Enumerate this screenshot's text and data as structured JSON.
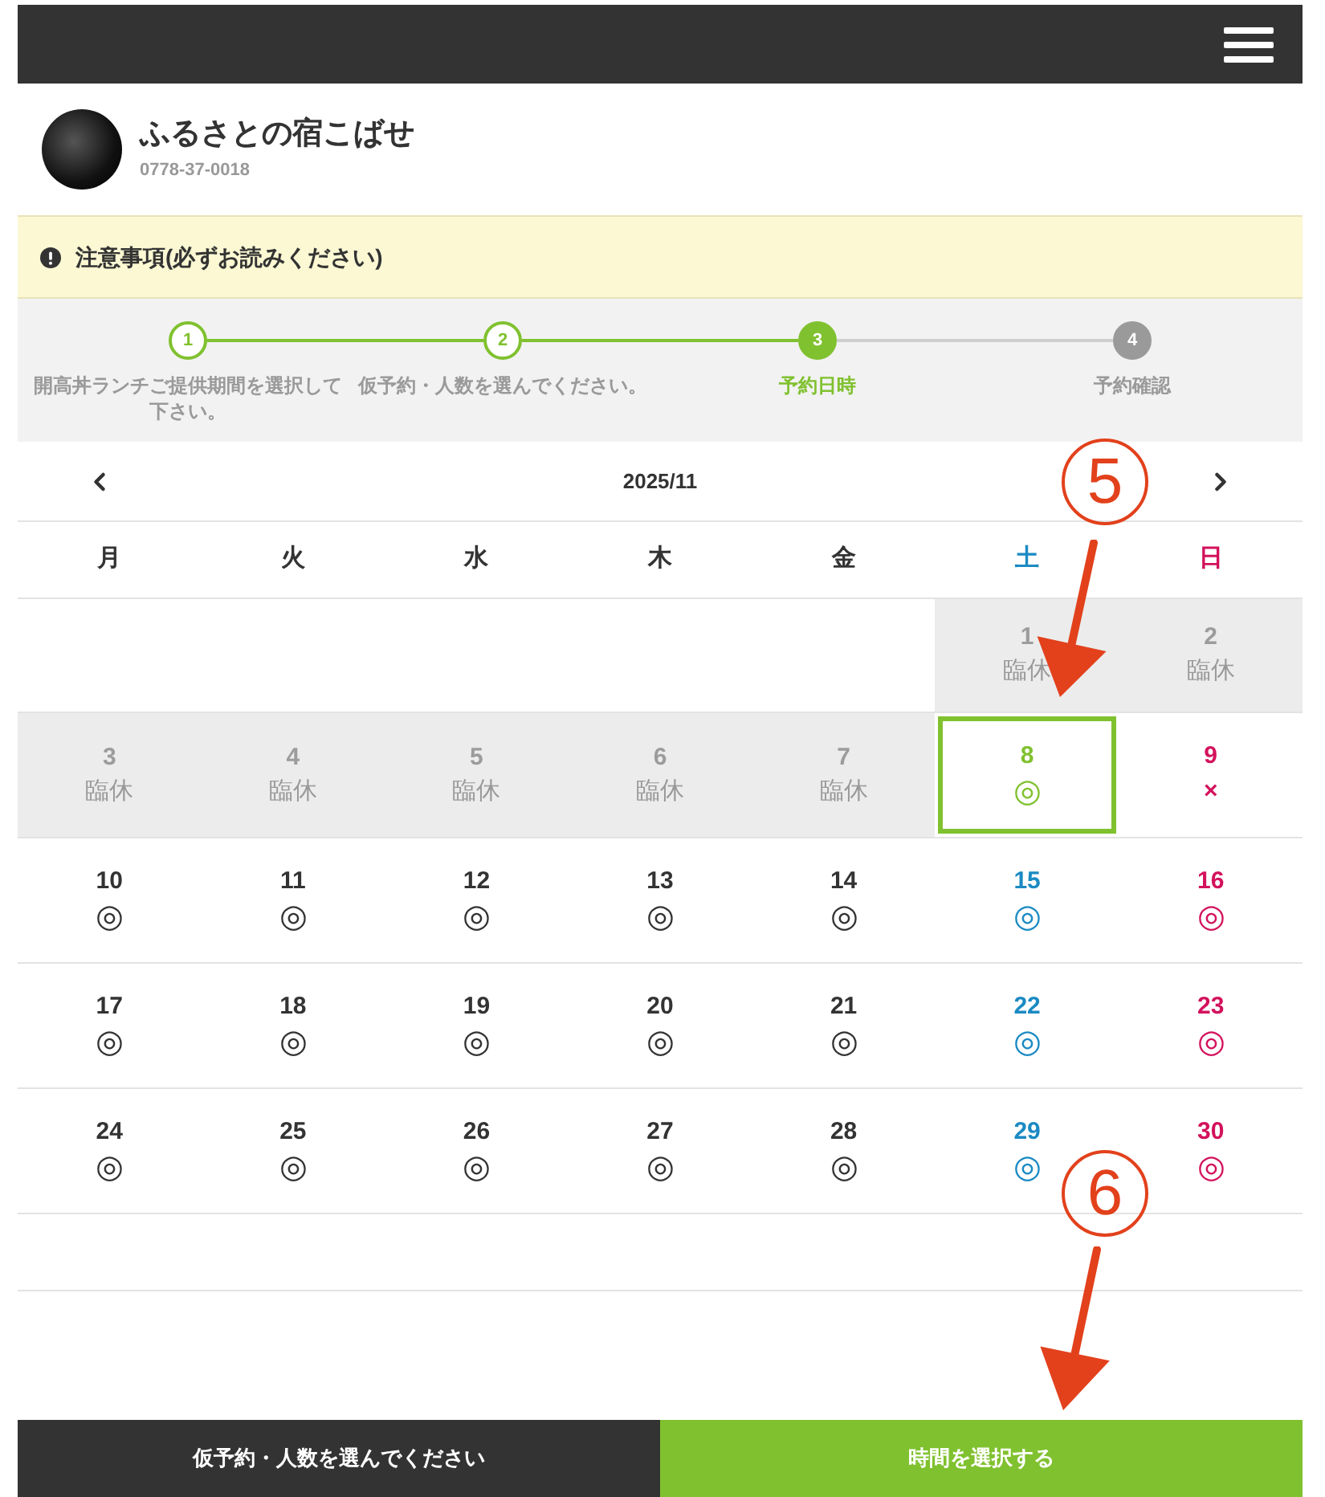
{
  "brand": {
    "name": "ふるさとの宿こばせ",
    "phone": "0778-37-0018"
  },
  "notice": {
    "text": "注意事項(必ずお読みください)"
  },
  "steps": [
    {
      "number": "1",
      "label": "開高丼ランチご提供期間を選択して下さい。",
      "completed": true,
      "selected": false
    },
    {
      "number": "2",
      "label": "仮予約・人数を選んでください。",
      "completed": true,
      "selected": false
    },
    {
      "number": "3",
      "label": "予約日時",
      "completed": false,
      "selected": true
    },
    {
      "number": "4",
      "label": "予約確認",
      "completed": false,
      "selected": false
    }
  ],
  "calendar": {
    "month": "2025/11",
    "weekdays": [
      {
        "label": "月",
        "color": "#333333"
      },
      {
        "label": "火",
        "color": "#333333"
      },
      {
        "label": "水",
        "color": "#333333"
      },
      {
        "label": "木",
        "color": "#333333"
      },
      {
        "label": "金",
        "color": "#333333"
      },
      {
        "label": "土",
        "color": "#1b8ac3"
      },
      {
        "label": "日",
        "color": "#d3125c"
      }
    ],
    "weeks": [
      [
        {
          "kind": "blank"
        },
        {
          "kind": "blank"
        },
        {
          "kind": "blank"
        },
        {
          "kind": "blank"
        },
        {
          "kind": "blank"
        },
        {
          "kind": "closed",
          "date": "1",
          "note": "臨休",
          "selected": false
        },
        {
          "kind": "closed",
          "date": "2",
          "note": "臨休",
          "selected": false
        }
      ],
      [
        {
          "kind": "closed",
          "date": "3",
          "note": "臨休",
          "selected": false
        },
        {
          "kind": "closed",
          "date": "4",
          "note": "臨休",
          "selected": false
        },
        {
          "kind": "closed",
          "date": "5",
          "note": "臨休",
          "selected": false
        },
        {
          "kind": "closed",
          "date": "6",
          "note": "臨休",
          "selected": false
        },
        {
          "kind": "closed",
          "date": "7",
          "note": "臨休",
          "selected": false
        },
        {
          "kind": "open",
          "date": "8",
          "mark": "◎",
          "selected": true
        },
        {
          "kind": "full",
          "date": "9",
          "mark": "×",
          "selected": false
        }
      ],
      [
        {
          "kind": "open",
          "date": "10",
          "mark": "◎",
          "selected": false
        },
        {
          "kind": "open",
          "date": "11",
          "mark": "◎",
          "selected": false
        },
        {
          "kind": "open",
          "date": "12",
          "mark": "◎",
          "selected": false
        },
        {
          "kind": "open",
          "date": "13",
          "mark": "◎",
          "selected": false
        },
        {
          "kind": "open",
          "date": "14",
          "mark": "◎",
          "selected": false
        },
        {
          "kind": "open",
          "date": "15",
          "mark": "◎",
          "selected": false
        },
        {
          "kind": "open",
          "date": "16",
          "mark": "◎",
          "selected": false
        }
      ],
      [
        {
          "kind": "open",
          "date": "17",
          "mark": "◎",
          "selected": false
        },
        {
          "kind": "open",
          "date": "18",
          "mark": "◎",
          "selected": false
        },
        {
          "kind": "open",
          "date": "19",
          "mark": "◎",
          "selected": false
        },
        {
          "kind": "open",
          "date": "20",
          "mark": "◎",
          "selected": false
        },
        {
          "kind": "open",
          "date": "21",
          "mark": "◎",
          "selected": false
        },
        {
          "kind": "open",
          "date": "22",
          "mark": "◎",
          "selected": false
        },
        {
          "kind": "open",
          "date": "23",
          "mark": "◎",
          "selected": false
        }
      ],
      [
        {
          "kind": "open",
          "date": "24",
          "mark": "◎",
          "selected": false
        },
        {
          "kind": "open",
          "date": "25",
          "mark": "◎",
          "selected": false
        },
        {
          "kind": "open",
          "date": "26",
          "mark": "◎",
          "selected": false
        },
        {
          "kind": "open",
          "date": "27",
          "mark": "◎",
          "selected": false
        },
        {
          "kind": "open",
          "date": "28",
          "mark": "◎",
          "selected": false
        },
        {
          "kind": "open",
          "date": "29",
          "mark": "◎",
          "selected": false
        },
        {
          "kind": "open",
          "date": "30",
          "mark": "◎",
          "selected": false
        }
      ]
    ]
  },
  "footer_buttons": [
    {
      "label": "仮予約・人数を選んでください",
      "kind": "back"
    },
    {
      "label": "時間を選択する",
      "kind": "next"
    }
  ],
  "annotations": [
    {
      "label": "5"
    },
    {
      "label": "6"
    }
  ]
}
